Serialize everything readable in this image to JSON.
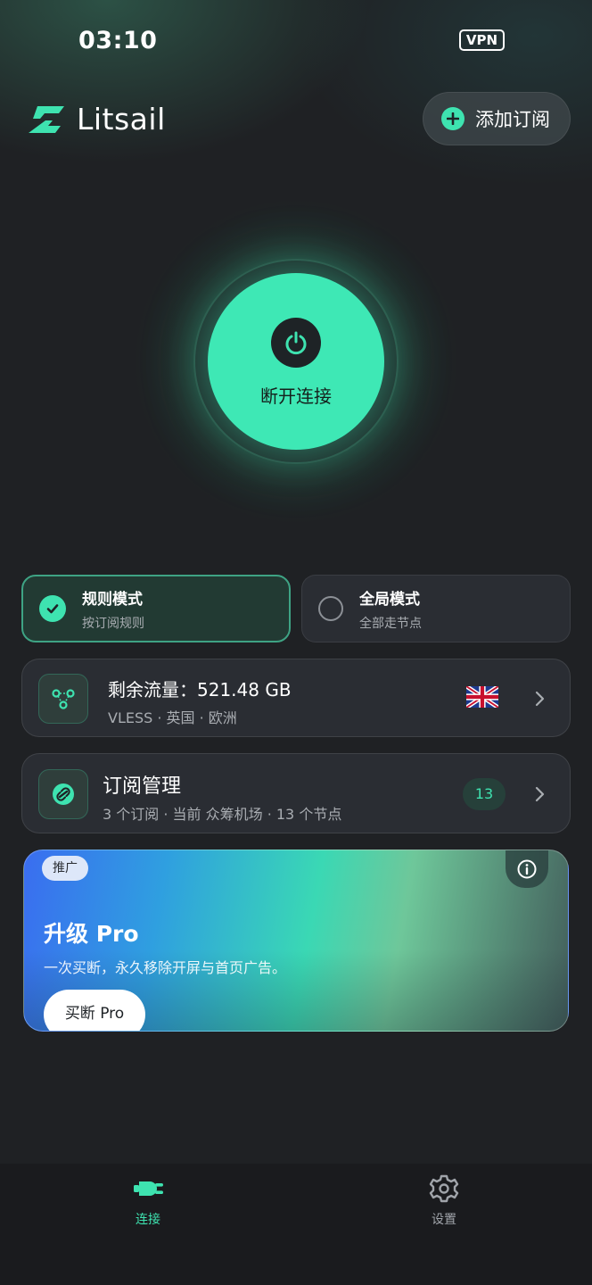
{
  "status_bar": {
    "time": "03:10",
    "vpn_badge": "VPN"
  },
  "header": {
    "app_name": "Litsail",
    "add_subscription_label": "添加订阅"
  },
  "connection": {
    "button_label": "断开连接",
    "state": "connected"
  },
  "modes": [
    {
      "title": "规则模式",
      "subtitle": "按订阅规则",
      "selected": true
    },
    {
      "title": "全局模式",
      "subtitle": "全部走节点",
      "selected": false
    }
  ],
  "traffic": {
    "title": "剩余流量：521.48 GB",
    "detail": "VLESS · 英国 · 欧洲",
    "flag_icon": "uk-flag-icon"
  },
  "subscription": {
    "title": "订阅管理",
    "detail": "3 个订阅 · 当前 众筹机场 · 13 个节点",
    "count": "13"
  },
  "promo": {
    "tag": "推广",
    "title": "升级 Pro",
    "description": "一次买断，永久移除开屏与首页广告。",
    "button_label": "买断 Pro"
  },
  "tabs": [
    {
      "label": "连接",
      "icon": "plug-icon",
      "active": true
    },
    {
      "label": "设置",
      "icon": "gear-icon",
      "active": false
    }
  ],
  "colors": {
    "accent": "#3ee3b0",
    "background": "#1f2124",
    "card": "#2a2d33",
    "selected_card": "#223a33"
  }
}
